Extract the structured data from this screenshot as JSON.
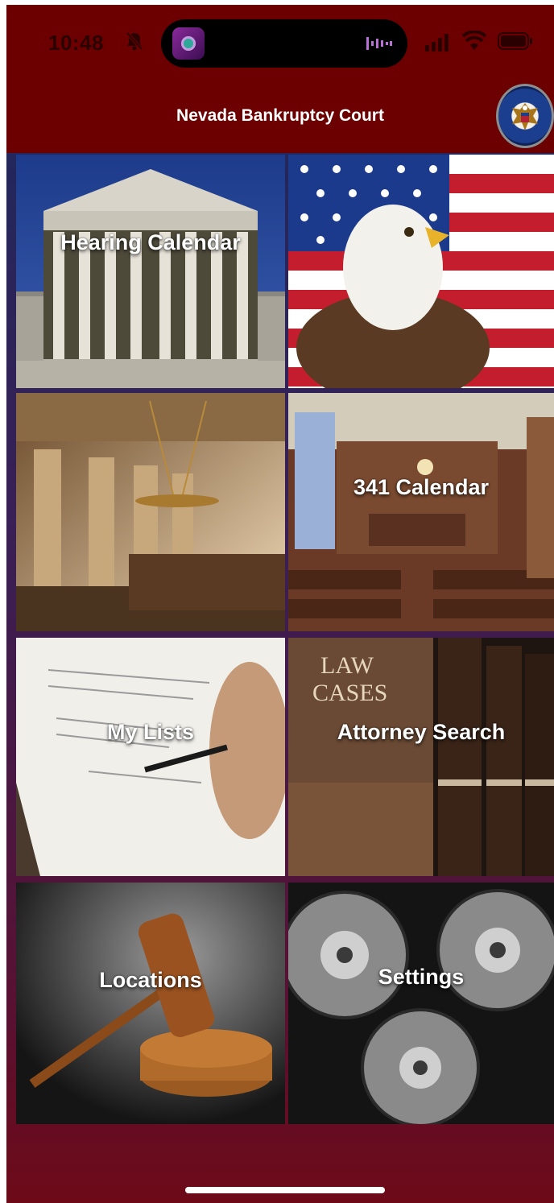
{
  "status_bar": {
    "time": "10:48",
    "icons": [
      "bell-slash-icon",
      "podcast-artwork-icon",
      "audio-waveform-icon",
      "signal-icon",
      "wifi-icon",
      "battery-icon"
    ]
  },
  "header": {
    "title": "Nevada Bankruptcy Court",
    "seal_icon": "united-states-courts-seal-icon",
    "bar_color": "#6c0000"
  },
  "tiles": [
    {
      "label": "Hearing Calendar",
      "image": "supreme-court-building"
    },
    {
      "label": "",
      "image": "bald-eagle-american-flag"
    },
    {
      "label": "",
      "image": "scales-of-justice-columns"
    },
    {
      "label": "341 Calendar",
      "image": "courtroom-interior"
    },
    {
      "label": "My Lists",
      "image": "hand-signing-document"
    },
    {
      "label": "Attorney Search",
      "image": "law-cases-books"
    },
    {
      "label": "Locations",
      "image": "judge-gavel"
    },
    {
      "label": "Settings",
      "image": "metal-gears"
    }
  ],
  "colors": {
    "header": "#6c0000",
    "background_top": "#1a2a5e",
    "background_bottom": "#6e0a18",
    "label_text": "#ffffff"
  }
}
